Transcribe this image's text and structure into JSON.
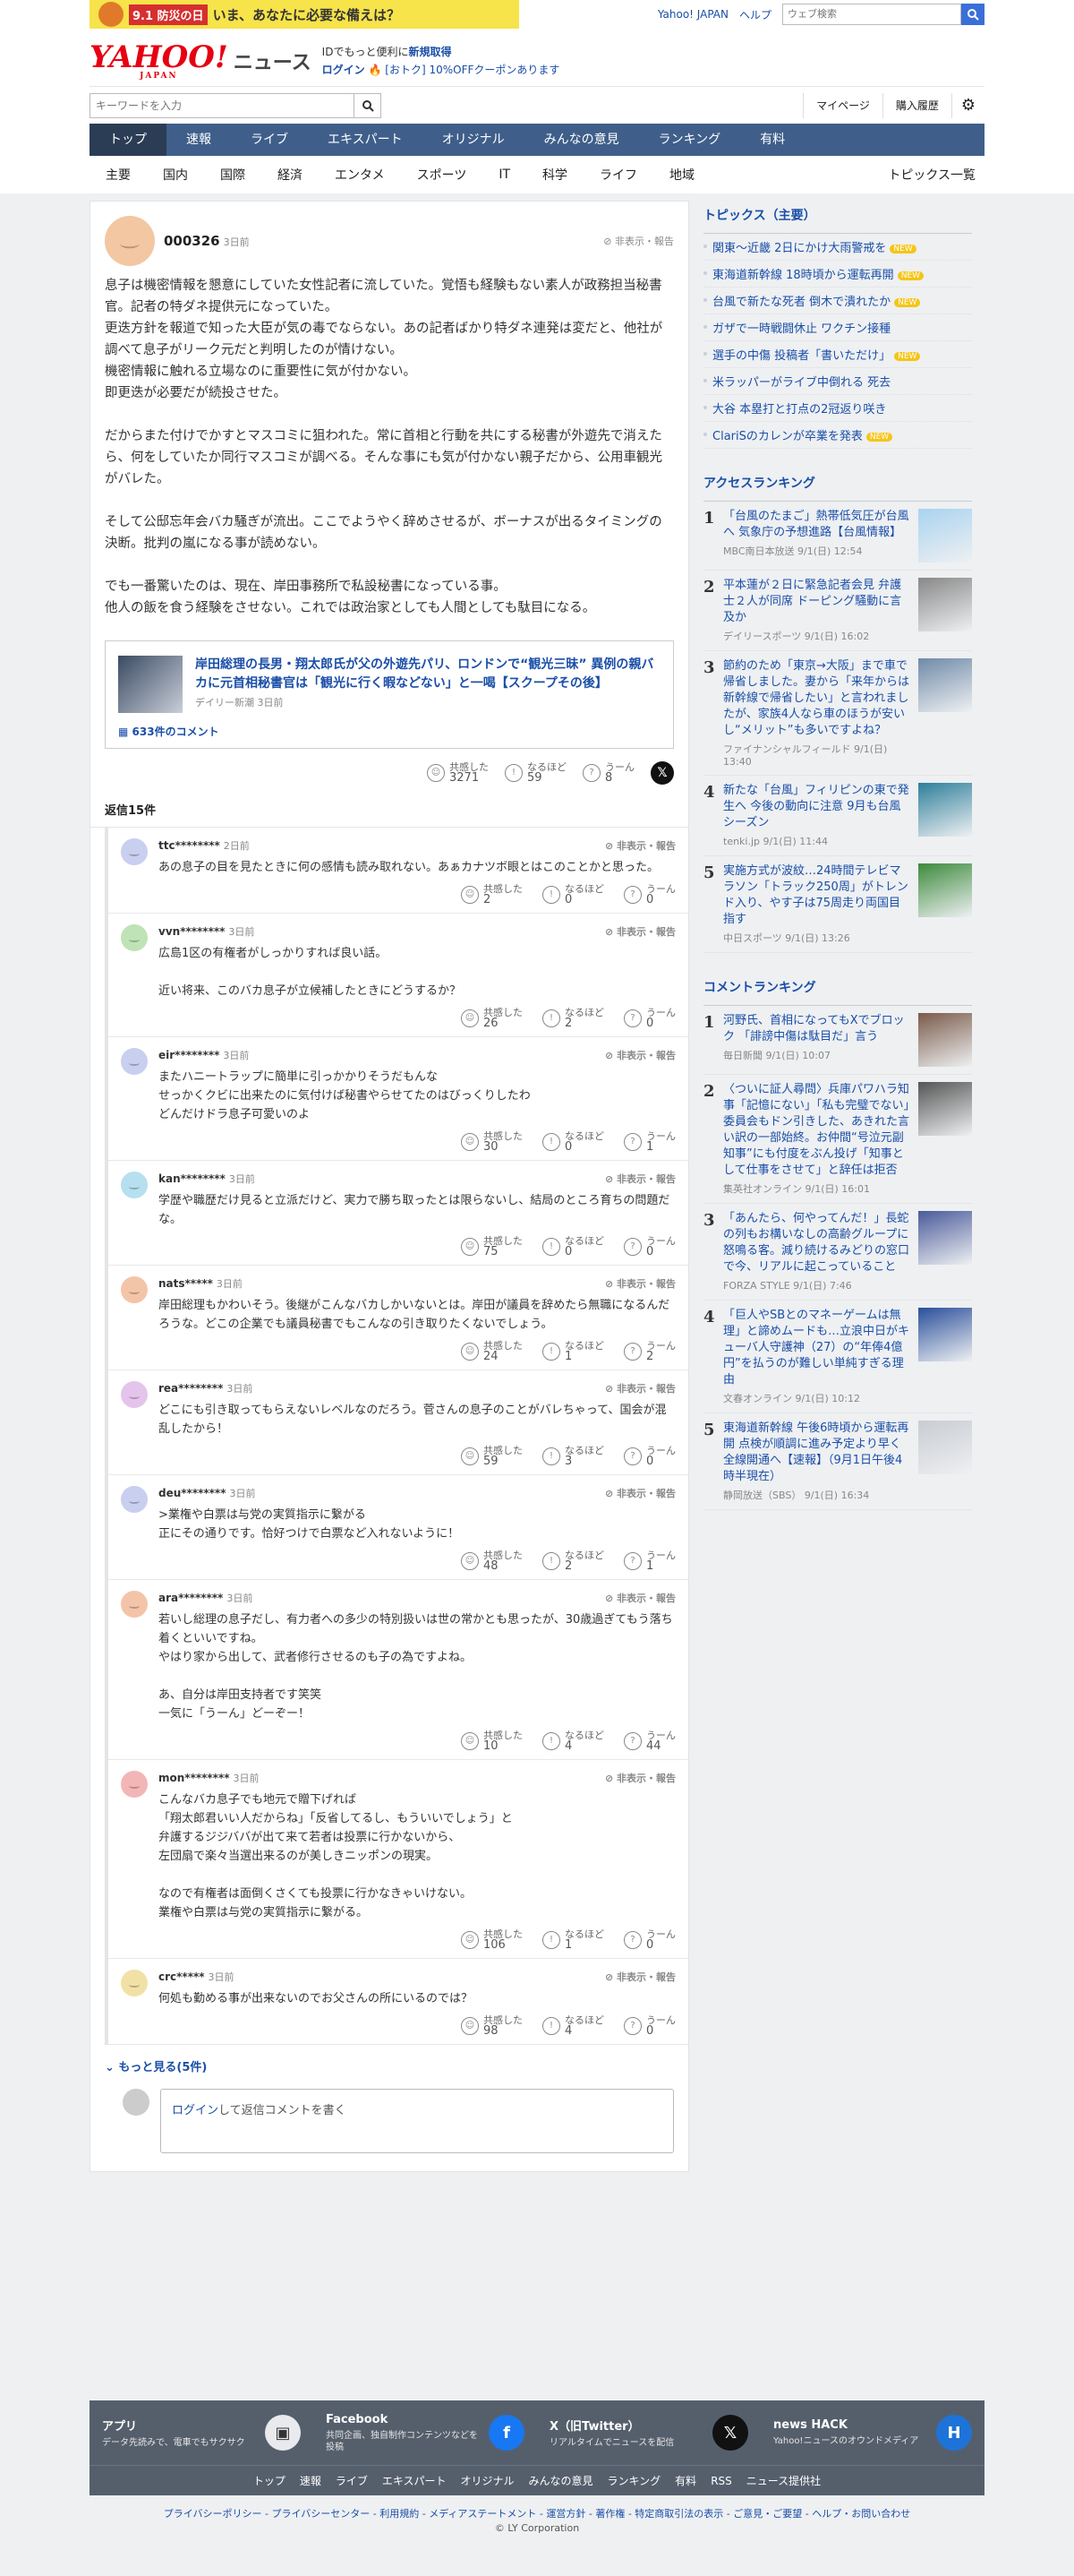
{
  "promo": {
    "label": "9.1 防災の日",
    "text": "いま、あなたに必要な備えは？"
  },
  "yj": {
    "portal": "Yahoo! JAPAN",
    "help": "ヘルプ",
    "search_placeholder": "ウェブ検索"
  },
  "header": {
    "logo": "YAHOO!",
    "logo_sub": "JAPAN",
    "service": "ニュース",
    "msg1_a": "IDでもっと便利に",
    "msg1_b": "新規取得",
    "msg2_a": "ログイン",
    "msg2_b": "[おトク] 10%OFFクーポンあります"
  },
  "search": {
    "placeholder": "キーワードを入力",
    "mypage": "マイページ",
    "purchase": "購入履歴"
  },
  "gnav": [
    "トップ",
    "速報",
    "ライブ",
    "エキスパート",
    "オリジナル",
    "みんなの意見",
    "ランキング",
    "有料"
  ],
  "cnav": [
    "主要",
    "国内",
    "国際",
    "経済",
    "エンタメ",
    "スポーツ",
    "IT",
    "科学",
    "ライフ",
    "地域"
  ],
  "cnav_all": "トピックス一覧",
  "top_comment": {
    "user": "000326",
    "ago": "3日前",
    "report": "非表示・報告",
    "paras": [
      "息子は機密情報を懇意にしていた女性記者に流していた。覚悟も経験もない素人が政務担当秘書官。記者の特ダネ提供元になっていた。\n更迭方針を報道で知った大臣が気の毒でならない。あの記者ばかり特ダネ連発は変だと、他社が調べて息子がリーク元だと判明したのが情けない。\n機密情報に触れる立場なのに重要性に気が付かない。\n即更迭が必要だが続投させた。",
      "だからまた付けでかすとマスコミに狙われた。常に首相と行動を共にする秘書が外遊先で消えたら、何をしていたか同行マスコミが調べる。そんな事にも気が付かない親子だから、公用車観光がバレた。",
      "そして公邸忘年会バカ騒ぎが流出。ここでようやく辞めさせるが、ボーナスが出るタイミングの決断。批判の嵐になる事が読めない。",
      "でも一番驚いたのは、現在、岸田事務所で私設秘書になっている事。\n他人の飯を食う経験をさせない。これでは政治家としても人間としても駄目になる。"
    ],
    "article": {
      "title": "岸田総理の長男・翔太郎氏が父の外遊先パリ、ロンドンで“観光三昧” 異例の親バカに元首相秘書官は「観光に行く暇などない」と一喝【スクープその後】",
      "source": "デイリー新潮 3日前",
      "comments": "633件のコメント"
    },
    "react": {
      "empathy": "3271",
      "naruhodo": "59",
      "uun": "8"
    }
  },
  "labels": {
    "empathy": "共感した",
    "naruhodo": "なるほど",
    "uun": "うーん",
    "replies": "返信15件",
    "more": "もっと見る(5件)",
    "login": "ログイン",
    "compose": "して返信コメントを書く"
  },
  "replies": [
    {
      "user": "ttc********",
      "ago": "2日前",
      "text": "あの息子の目を見たときに何の感情も読み取れない。あぁカナツボ眼とはこのことかと思った。",
      "e": "2",
      "n": "0",
      "u": "0",
      "color": "#c9cfee"
    },
    {
      "user": "vvn********",
      "ago": "3日前",
      "text": "広島1区の有権者がしっかりすれば良い話。\n\n近い将来、このバカ息子が立候補したときにどうするか？",
      "e": "26",
      "n": "2",
      "u": "0",
      "color": "#bfe3b6"
    },
    {
      "user": "eir********",
      "ago": "3日前",
      "text": "またハニートラップに簡単に引っかかりそうだもんな\nせっかくクビに出来たのに気付けば秘書やらせてたのはびっくりしたわ\nどんだけドラ息子可愛いのよ",
      "e": "30",
      "n": "0",
      "u": "1",
      "color": "#c9cfee"
    },
    {
      "user": "kan********",
      "ago": "3日前",
      "text": "学歴や職歴だけ見ると立派だけど、実力で勝ち取ったとは限らないし、結局のところ育ちの問題だな。",
      "e": "75",
      "n": "0",
      "u": "0",
      "color": "#b6dff0"
    },
    {
      "user": "nats*****",
      "ago": "3日前",
      "text": "岸田総理もかわいそう。後継がこんなバカしかいないとは。岸田が議員を辞めたら無職になるんだろうな。どこの企業でも議員秘書でもこんなの引き取りたくないでしょう。",
      "e": "24",
      "n": "1",
      "u": "2",
      "color": "#f4c4a8"
    },
    {
      "user": "rea********",
      "ago": "3日前",
      "text": "どこにも引き取ってもらえないレベルなのだろう。菅さんの息子のことがバレちゃって、国会が混乱したから！",
      "e": "59",
      "n": "3",
      "u": "0",
      "color": "#e5c4ec"
    },
    {
      "user": "deu********",
      "ago": "3日前",
      "text": ">業権や白票は与党の実質指示に繋がる\n正にその通りです。恰好つけで白票など入れないように！",
      "e": "48",
      "n": "2",
      "u": "1",
      "color": "#c9cfee"
    },
    {
      "user": "ara********",
      "ago": "3日前",
      "text": "若いし総理の息子だし、有力者への多少の特別扱いは世の常かとも思ったが、30歳過ぎてもう落ち着くといいですね。\nやはり家から出して、武者修行させるのも子の為ですよね。\n\nあ、自分は岸田支持者です笑笑\n一気に「うーん」どーぞー！",
      "e": "10",
      "n": "4",
      "u": "44",
      "color": "#f4c4a8"
    },
    {
      "user": "mon********",
      "ago": "3日前",
      "text": "こんなバカ息子でも地元で贈下げれば\n「翔太郎君いい人だからね」「反省してるし、もういいでしょう」と\n弁護するジジババが出て来て若者は投票に行かないから、\n左団扇で楽々当選出来るのが美しきニッポンの現実。\n\nなので有権者は面倒くさくても投票に行かなきゃいけない。\n業権や白票は与党の実質指示に繋がる。",
      "e": "106",
      "n": "1",
      "u": "0",
      "color": "#f2b6b6"
    },
    {
      "user": "crc*****",
      "ago": "3日前",
      "text": "何処も勤める事が出来ないのでお父さんの所にいるのでは？",
      "e": "98",
      "n": "4",
      "u": "0",
      "color": "#f2e1a6"
    }
  ],
  "side": {
    "topics_h": "トピックス（主要）",
    "topics": [
      {
        "t": "関東〜近畿 2日にかけ大雨警戒を",
        "new": "NEW"
      },
      {
        "t": "東海道新幹線 18時頃から運転再開",
        "new": "NEW"
      },
      {
        "t": "台風で新たな死者 倒木で潰れたか",
        "new": "NEW"
      },
      {
        "t": "ガザで一時戦闘休止 ワクチン接種",
        "new": ""
      },
      {
        "t": "選手の中傷 投稿者「書いただけ」",
        "new": "NEW"
      },
      {
        "t": "米ラッパーがライブ中倒れる 死去",
        "new": ""
      },
      {
        "t": "大谷 本塁打と打点の2冠返り咲き",
        "new": ""
      },
      {
        "t": "ClariSのカレンが卒業を発表",
        "new": "NEW"
      }
    ],
    "access_h": "アクセスランキング",
    "access": [
      {
        "t": "「台風のたまご」熱帯低気圧が台風へ 気象庁の予想進路【台風情報】",
        "s": "MBC南日本放送 9/1(日) 12:54",
        "img": true,
        "c": "#a9d3ef"
      },
      {
        "t": "平本蓮が２日に緊急記者会見 弁護士２人が同席 ドーピング騒動に言及か",
        "s": "デイリースポーツ 9/1(日) 16:02",
        "img": true,
        "c": "#888"
      },
      {
        "t": "節約のため「東京→大阪」まで車で帰省しました。妻から「来年からは新幹線で帰省したい」と言われましたが、家族4人なら車のほうが安いし“メリット”も多いですよね？",
        "s": "ファイナンシャルフィールド 9/1(日) 13:40",
        "img": true,
        "c": "#6f8aa8"
      },
      {
        "t": "新たな「台風」フィリピンの東で発生へ 今後の動向に注意 9月も台風シーズン",
        "s": "tenki.jp 9/1(日) 11:44",
        "img": true,
        "c": "#2e7f9a"
      },
      {
        "t": "実施方式が波紋…24時間テレビマラソン「トラック250周」がトレンド入り、やす子は75周走り両国目指す",
        "s": "中日スポーツ 9/1(日) 13:26",
        "img": true,
        "c": "#3d8a3d"
      }
    ],
    "comment_h": "コメントランキング",
    "comment": [
      {
        "t": "河野氏、首相になってもXでブロック 「誹謗中傷は駄目だ」言う",
        "s": "毎日新聞 9/1(日) 10:07",
        "img": true,
        "c": "#7a5a4a"
      },
      {
        "t": "〈ついに証人尋問〉兵庫パワハラ知事「記憶にない」「私も完璧でない」委員会もドン引きした、あきれた言い訳の一部始終。お仲間“号泣元副知事”にも付度をぶん投げ「知事として仕事をさせて」と辞任は拒否",
        "s": "集英社オンライン 9/1(日) 16:01",
        "img": true,
        "c": "#555"
      },
      {
        "t": "「あんたら、何やってんだ！」長蛇の列もお構いなしの高齢グループに怒鳴る客。減り続けるみどりの窓口で今、リアルに起こっていること",
        "s": "FORZA STYLE 9/1(日) 7:46",
        "img": true,
        "c": "#4a5a9a"
      },
      {
        "t": "「巨人やSBとのマネーゲームは無理」と諦めムードも…立浪中日がキューバ人守護神（27）の“年俸4億円”を払うのが難しい単純すぎる理由",
        "s": "文春オンライン 9/1(日) 10:12",
        "img": true,
        "c": "#2a4f9a"
      },
      {
        "t": "東海道新幹線 午後6時頃から運転再開 点検が順調に進み予定より早く全線開通へ【速報】（9月1日午後4時半現在）",
        "s": "静岡放送（SBS） 9/1(日) 16:34",
        "img": true,
        "c": "#c9ccd2"
      }
    ]
  },
  "footer": {
    "cols": [
      {
        "t": "アプリ",
        "d": "データ先読みで、電車でもサクサク"
      },
      {
        "t": "Facebook",
        "d": "共同企画、独自制作コンテンツなどを投稿"
      },
      {
        "t": "X（旧Twitter）",
        "d": "リアルタイムでニュースを配信"
      },
      {
        "t": "news HACK",
        "d": "Yahoo!ニュースのオウンドメディア"
      }
    ],
    "links": [
      "トップ",
      "速報",
      "ライブ",
      "エキスパート",
      "オリジナル",
      "みんなの意見",
      "ランキング",
      "有料",
      "RSS",
      "ニュース提供社"
    ],
    "legal": "プライバシーポリシー - プライバシーセンター - 利用規約 - メディアステートメント - 運営方針 - 著作権 - 特定商取引法の表示 - ご意見・ご要望 - ヘルプ・お問い合わせ",
    "copy": "© LY Corporation"
  },
  "colors": {
    "accent": "#1a4ea8",
    "nav": "#3f5f8a",
    "brand": "#e60012"
  }
}
